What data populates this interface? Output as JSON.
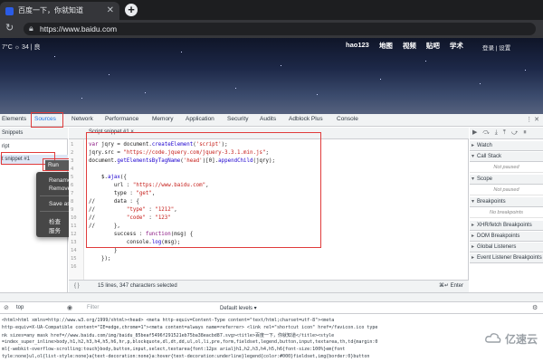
{
  "browser": {
    "tab_title": "百度一下，你就知道",
    "tab_close": "✕",
    "new_tab": "+",
    "url": "https://www.baidu.com"
  },
  "baidu_page": {
    "weather": "7°C ☼ 34 | 良",
    "nav_links": [
      "hao123",
      "地图",
      "视频",
      "贴吧",
      "学术"
    ],
    "right_text": "登录 | 设置"
  },
  "devtools": {
    "tabs": [
      "Elements",
      "Sources",
      "Network",
      "Performance",
      "Memory",
      "Application",
      "Security",
      "Audits",
      "Adblock Plus",
      "Console"
    ],
    "active_tab": "Sources",
    "navigator": {
      "header": "Snippets",
      "rows": [
        "ript",
        "t snippet #1"
      ]
    },
    "context_menu": {
      "run": "Run",
      "items": [
        "Rename...",
        "Remove",
        "Save as...",
        "检查",
        "服务"
      ]
    },
    "editor": {
      "tab_label": "Script snippet #1 ×",
      "line_numbers": [
        "1",
        "2",
        "3",
        "4",
        "5",
        "6",
        "7",
        "8",
        "9",
        "10",
        "11",
        "12",
        "13",
        "14",
        "15",
        "16"
      ],
      "status": "15 lines, 347 characters selected",
      "ctrl_enter": "⌘↵ Enter"
    },
    "debugger": {
      "toolbar": "▶ ⤼ ⤓ ⤒ ⤻ ⏸",
      "sections": [
        {
          "label": "Watch",
          "open": false
        },
        {
          "label": "Call Stack",
          "open": true
        },
        {
          "label": "Scope",
          "open": true
        },
        {
          "label": "Breakpoints",
          "open": true
        },
        {
          "label": "XHR/fetch Breakpoints",
          "open": false
        },
        {
          "label": "DOM Breakpoints",
          "open": false
        },
        {
          "label": "Global Listeners",
          "open": false
        },
        {
          "label": "Event Listener Breakpoints",
          "open": false
        }
      ],
      "not_paused": "Not paused",
      "no_breakpoints": "No breakpoints"
    },
    "console": {
      "context": "top",
      "filter_placeholder": "Filter",
      "levels": "Default levels ▾",
      "lines": [
        "<html>html xmlns=http://www.w3.org/1999/xhtml><head>     <meta http-equiv=Content-Type content=\"text/html;charset=utf-8\"><meta",
        "http-equiv=X-UA-Compatible content=\"IE=edge,chrome=1\"><meta content=always name=referrer>  <link rel=\"shortcut icon\" href=/favicon.ico type",
        "nk sizes=any mask href=//www.baidu.com/img/baidu_85beaf5496f291521eb75ba38eacbd87.svg><title>百度一下，你就知道</title><style",
        "=index_super_inline>body,h1,h2,h3,h4,h5,h6,hr,p,blockquote,dl,dt,dd,ul,ol,li,pre,form,fieldset,legend,button,input,textarea,th,td{margin:0",
        "ml{-webkit-overflow-scrolling:touch}body,button,input,select,textarea{font:12px arial}h1,h2,h3,h4,h5,h6{font-size:100%}em{font",
        "tyle:none}ul,ol{list-style:none}a{text-decoration:none}a:hover{text-decoration:underline}legend{color:#000}fieldset,img{border:0}button"
      ]
    }
  },
  "watermark": {
    "text": "亿速云"
  },
  "colors": {
    "highlight_box": "#e03b3b",
    "devtools_active": "#1a73e8",
    "context_menu_bg": "#474747"
  }
}
